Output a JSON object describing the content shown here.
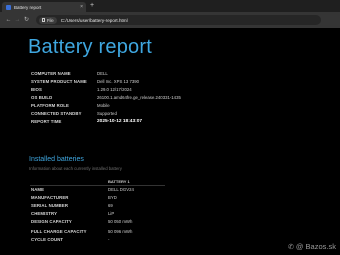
{
  "browser": {
    "tab_title": "Battery report",
    "tab_close": "×",
    "new_tab": "+",
    "nav": {
      "back": "←",
      "forward": "→",
      "reload": "↻"
    },
    "chip_label": "File",
    "url": "C:/Users/user/battery-report.html"
  },
  "report": {
    "title": "Battery report",
    "system_info": [
      {
        "label": "COMPUTER NAME",
        "value": "DELL"
      },
      {
        "label": "SYSTEM PRODUCT NAME",
        "value": "Dell Inc. XPS 13 7390"
      },
      {
        "label": "BIOS",
        "value": "1.29.0 12/17/2024"
      },
      {
        "label": "OS BUILD",
        "value": "26100.1.amd64fre.ge_release.240331-1435"
      },
      {
        "label": "PLATFORM ROLE",
        "value": "Mobile"
      },
      {
        "label": "CONNECTED STANDBY",
        "value": "Supported"
      },
      {
        "label": "REPORT TIME",
        "value": "2025-10-12   18:43:07"
      }
    ],
    "installed_batteries": {
      "title": "Installed batteries",
      "subtitle": "Information about each currently installed battery",
      "column_header": "BATTERY 1",
      "rows": [
        {
          "label": "NAME",
          "value": "DELL DGV24"
        },
        {
          "label": "MANUFACTURER",
          "value": "BYD"
        },
        {
          "label": "SERIAL NUMBER",
          "value": "69"
        },
        {
          "label": "CHEMISTRY",
          "value": "LiP"
        },
        {
          "label": "DESIGN CAPACITY",
          "value": "50 050 mWh"
        },
        {
          "label": "FULL CHARGE CAPACITY",
          "value": "50 096 mWh"
        },
        {
          "label": "CYCLE COUNT",
          "value": "-"
        }
      ]
    }
  },
  "watermark": {
    "icon": "✆",
    "text": "@ Bazos.sk"
  },
  "colors": {
    "accent": "#3fa7e0",
    "background": "#000000",
    "chrome": "#353535"
  }
}
